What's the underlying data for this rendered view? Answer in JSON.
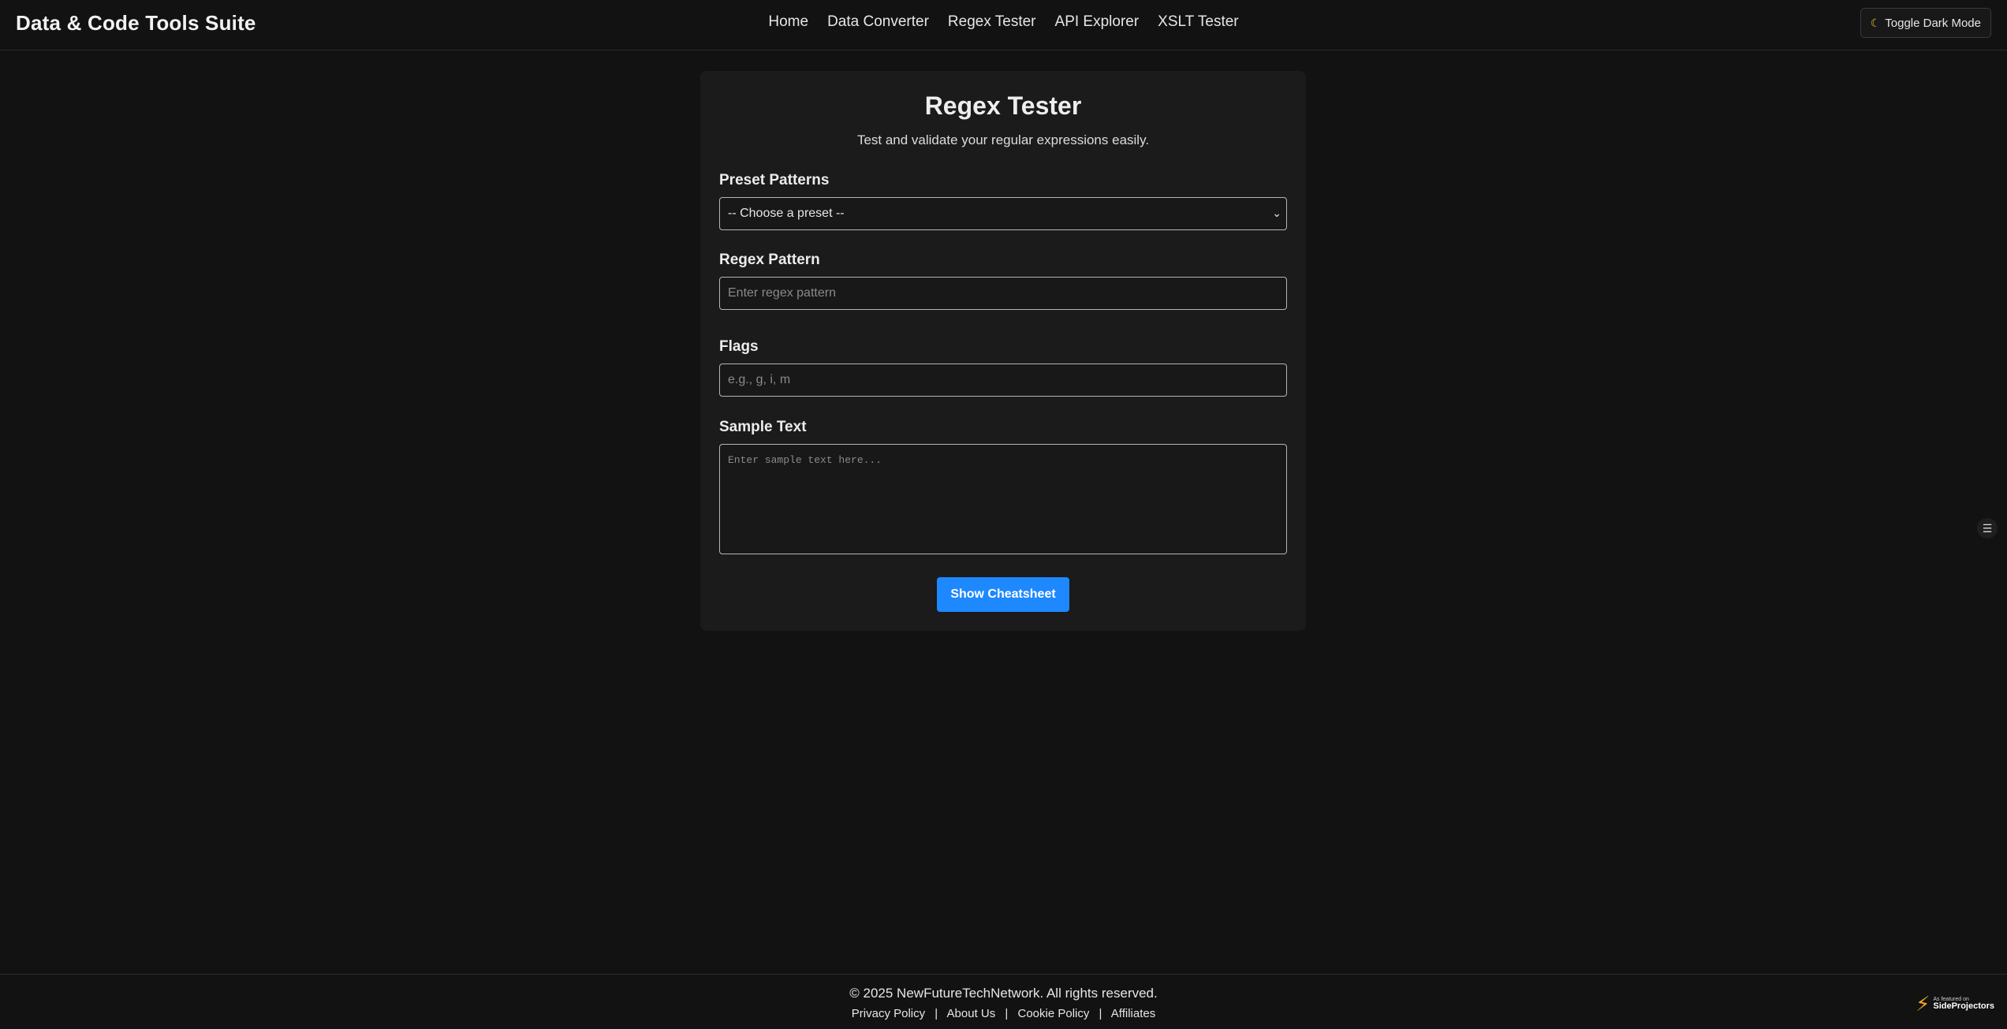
{
  "header": {
    "brand": "Data & Code Tools Suite",
    "nav": [
      "Home",
      "Data Converter",
      "Regex Tester",
      "API Explorer",
      "XSLT Tester"
    ],
    "toggle_label": "Toggle Dark Mode",
    "toggle_icon": "moon-icon"
  },
  "main": {
    "title": "Regex Tester",
    "subtitle": "Test and validate your regular expressions easily.",
    "preset": {
      "label": "Preset Patterns",
      "selected": "-- Choose a preset --"
    },
    "pattern": {
      "label": "Regex Pattern",
      "placeholder": "Enter regex pattern",
      "value": ""
    },
    "flags": {
      "label": "Flags",
      "placeholder": "e.g., g, i, m",
      "value": ""
    },
    "sample": {
      "label": "Sample Text",
      "placeholder": "Enter sample text here...",
      "value": ""
    },
    "cheatsheet_button": "Show Cheatsheet"
  },
  "side_widget": {
    "icon": "settings-sliders-icon"
  },
  "footer": {
    "copyright": "© 2025 NewFutureTechNetwork. All rights reserved.",
    "links": [
      "Privacy Policy",
      "About Us",
      "Cookie Policy",
      "Affiliates"
    ],
    "separator": "|",
    "badge": {
      "small": "As featured on",
      "big": "SideProjectors"
    }
  },
  "colors": {
    "background": "#121212",
    "card": "#1b1b1b",
    "accent": "#1e88ff",
    "badge_bolt": "#f5a623"
  }
}
